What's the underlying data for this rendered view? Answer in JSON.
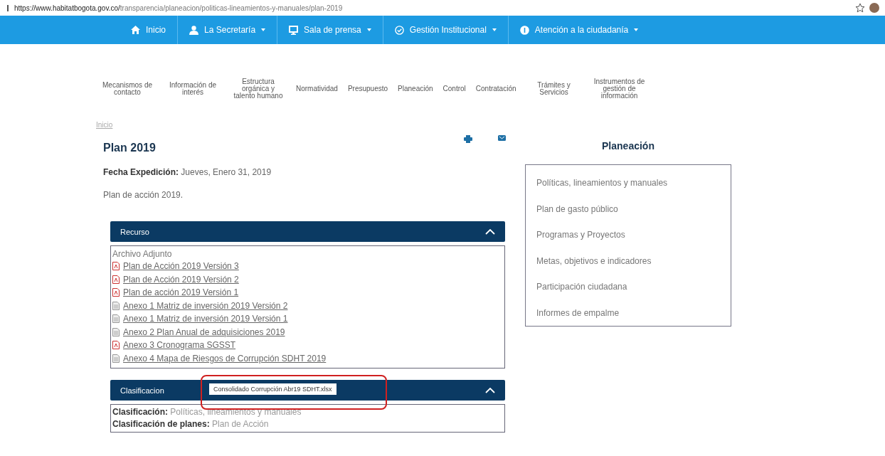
{
  "address_bar": {
    "url_host": "https://www.habitatbogota.gov.co/",
    "url_path": "transparencia/planeacion/politicas-lineamientos-y-manuales/plan-2019"
  },
  "main_nav": [
    {
      "label": "Inicio",
      "dropdown": false
    },
    {
      "label": "La Secretaría",
      "dropdown": true
    },
    {
      "label": "Sala de prensa",
      "dropdown": true
    },
    {
      "label": "Gestión Institucional",
      "dropdown": true
    },
    {
      "label": "Atención a la ciudadanía",
      "dropdown": true
    }
  ],
  "sub_nav": [
    "Mecanismos de contacto",
    "Información de interés",
    "Estructura orgánica y talento humano",
    "Normatividad",
    "Presupuesto",
    "Planeación",
    "Control",
    "Contratación",
    "Trámites y Servicios",
    "Instrumentos de gestión de información"
  ],
  "breadcrumb": "Inicio",
  "page_title": "Plan 2019",
  "date_label": "Fecha Expedición:",
  "date_value": "Jueves, Enero 31, 2019",
  "description": "Plan de acción 2019.",
  "resource_panel": {
    "title": "Recurso",
    "expanded": true,
    "heading": "Archivo Adjunto",
    "files": [
      {
        "kind": "pdf",
        "name": "Plan de Acción 2019 Versión 3"
      },
      {
        "kind": "pdf",
        "name": "Plan de Acción 2019 Versión 2"
      },
      {
        "kind": "pdf",
        "name": "Plan de acción 2019 Versión 1"
      },
      {
        "kind": "doc",
        "name": "Anexo 1 Matriz de inversión 2019 Versión 2"
      },
      {
        "kind": "doc",
        "name": "Anexo 1 Matriz de inversión 2019 Versión 1"
      },
      {
        "kind": "doc",
        "name": "Anexo 2 Plan Anual de adquisiciones 2019"
      },
      {
        "kind": "pdf",
        "name": "Anexo 3 Cronograma SGSST"
      },
      {
        "kind": "doc",
        "name": "Anexo 4 Mapa de Riesgos de Corrupción SDHT 2019"
      }
    ]
  },
  "classification_panel": {
    "title": "Clasificacion",
    "expanded": true,
    "rows": [
      {
        "label": "Clasificación:",
        "value": "Políticas, lineamientos y manuales"
      },
      {
        "label": "Clasificación de planes:",
        "value": "Plan de Acción"
      }
    ]
  },
  "tooltip": "Consolidado Corrupción Abr19 SDHT.xlsx",
  "sidebar": {
    "title": "Planeación",
    "items": [
      "Políticas, lineamientos y manuales",
      "Plan de gasto público",
      "Programas y Proyectos",
      "Metas, objetivos e indicadores",
      "Participación ciudadana",
      "Informes de empalme"
    ]
  }
}
